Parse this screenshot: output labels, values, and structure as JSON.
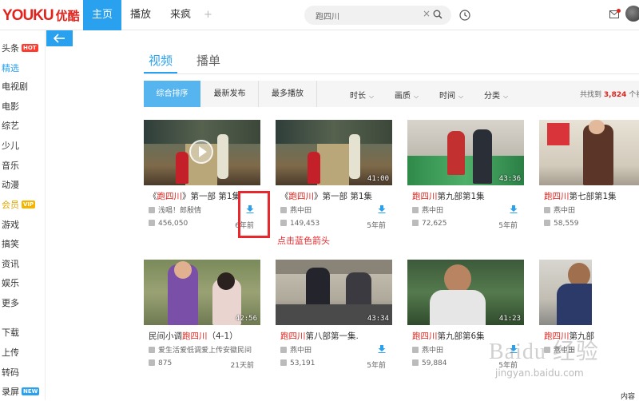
{
  "header": {
    "logo_latin": "YOUKU",
    "logo_cn": "优酷",
    "tabs": [
      {
        "label": "主页",
        "active": true
      },
      {
        "label": "播放",
        "active": false
      },
      {
        "label": "来疯",
        "active": false
      }
    ],
    "plus": "+",
    "search_value": "跑四川",
    "search_clear": "×"
  },
  "sidebar": {
    "items": [
      {
        "label": "头条",
        "badge": "HOT"
      },
      {
        "label": "精选",
        "active": true
      },
      {
        "label": "电视剧"
      },
      {
        "label": "电影"
      },
      {
        "label": "综艺"
      },
      {
        "label": "少儿"
      },
      {
        "label": "音乐"
      },
      {
        "label": "动漫"
      },
      {
        "label": "会员",
        "badge": "VIP"
      },
      {
        "label": "游戏"
      },
      {
        "label": "搞笑"
      },
      {
        "label": "资讯"
      },
      {
        "label": "娱乐"
      },
      {
        "label": "更多"
      },
      {
        "label": "下载"
      },
      {
        "label": "上传"
      },
      {
        "label": "转码"
      },
      {
        "label": "录屏",
        "badge": "NEW"
      }
    ]
  },
  "subtabs": [
    {
      "label": "视频",
      "active": true
    },
    {
      "label": "播单",
      "active": false
    }
  ],
  "filters": {
    "sort": [
      "综合排序",
      "最新发布",
      "最多播放"
    ],
    "dropdowns": [
      "时长",
      "画质",
      "时间",
      "分类"
    ],
    "result_prefix": "共找到",
    "result_count": "3,824",
    "result_suffix": "个视"
  },
  "videos": [
    {
      "title_pre": "《",
      "title_hl": "跑四川",
      "title_post": "》第一部 第1集",
      "uploader": "浅唱！郎殷情",
      "views": "456,050",
      "age": "6年前",
      "duration": "",
      "show_download": true
    },
    {
      "title_pre": "《",
      "title_hl": "跑四川",
      "title_post": "》第一部 第1集",
      "uploader": "燕中田",
      "views": "149,453",
      "age": "5年前",
      "duration": "41:00",
      "show_download": true
    },
    {
      "title_pre": "",
      "title_hl": "跑四川",
      "title_post": "第九部第1集",
      "uploader": "燕中田",
      "views": "72,625",
      "age": "5年前",
      "duration": "43:36",
      "show_download": true
    },
    {
      "title_pre": "",
      "title_hl": "跑四川",
      "title_post": "第七部第1集",
      "uploader": "燕中田",
      "views": "58,559",
      "age": "5年前",
      "duration": "",
      "show_download": true
    },
    {
      "title_pre": "民间小调",
      "title_hl": "跑四川",
      "title_post": "（4-1）",
      "uploader": "爱生活爱低调爱上传安徽民间",
      "views": "875",
      "age": "21天前",
      "duration": "42:56",
      "show_download": false
    },
    {
      "title_pre": "",
      "title_hl": "跑四川",
      "title_post": "第八部第一集.",
      "uploader": "燕中田",
      "views": "53,191",
      "age": "5年前",
      "duration": "43:34",
      "show_download": true
    },
    {
      "title_pre": "",
      "title_hl": "跑四川",
      "title_post": "第九部第6集",
      "uploader": "燕中田",
      "views": "59,884",
      "age": "5年前",
      "duration": "41:23",
      "show_download": true
    },
    {
      "title_pre": "",
      "title_hl": "跑四川",
      "title_post": "第九部",
      "uploader": "燕中田",
      "views": "",
      "age": "",
      "duration": "",
      "show_download": false
    }
  ],
  "annotation": "点击蓝色箭头",
  "watermark": "Baidu 经验",
  "watermark_url": "jingyan.baidu.com",
  "corner_text": "内容",
  "colors": {
    "accent": "#2aa1ef",
    "brand": "#e0231c",
    "annotation": "#e8282d"
  }
}
